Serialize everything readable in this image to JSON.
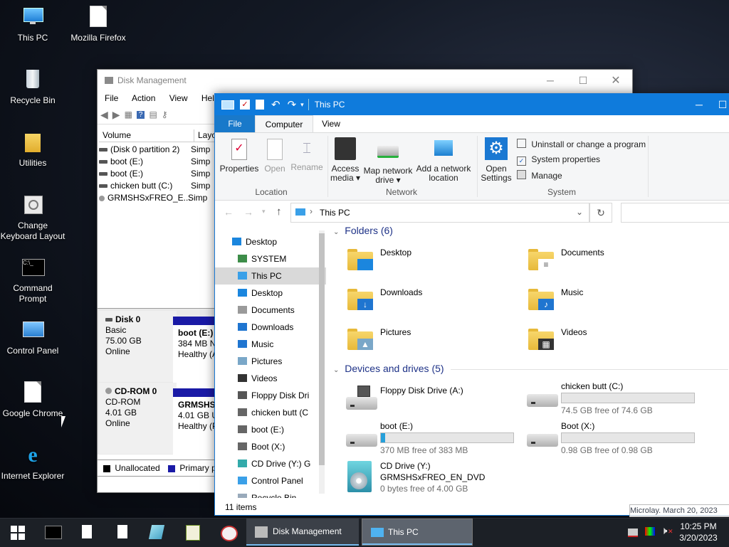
{
  "desktop": {
    "icons": [
      {
        "label": "This PC"
      },
      {
        "label": "Mozilla Firefox"
      },
      {
        "label": "Recycle Bin"
      },
      {
        "label": "Utilities"
      },
      {
        "label": "Change Keyboard Layout"
      },
      {
        "label": "Command Prompt"
      },
      {
        "label": "Control Panel"
      },
      {
        "label": "Google Chrome"
      },
      {
        "label": "Internet Explorer"
      }
    ],
    "watermark": "Microlay. March 20, 2023"
  },
  "disk_management": {
    "title": "Disk Management",
    "menu": [
      "File",
      "Action",
      "View",
      "Help"
    ],
    "columns": [
      "Volume",
      "Layout"
    ],
    "volumes": [
      {
        "name": "(Disk 0 partition 2)",
        "layout": "Simp"
      },
      {
        "name": "boot (E:)",
        "layout": "Simp"
      },
      {
        "name": "boot (E:)",
        "layout": "Simp"
      },
      {
        "name": "chicken butt (C:)",
        "layout": "Simp"
      },
      {
        "name": "GRMSHSxFREO_E...",
        "layout": "Simp"
      }
    ],
    "disks": [
      {
        "name": "Disk 0",
        "type": "Basic",
        "size": "75.00 GB",
        "status": "Online",
        "part_name": "boot  (E:)",
        "part_size": "384 MB N",
        "part_status": "Healthy (A"
      },
      {
        "name": "CD-ROM 0",
        "type": "CD-ROM",
        "size": "4.01 GB",
        "status": "Online",
        "part_name": "GRMSHS",
        "part_size": "4.01 GB U",
        "part_status": "Healthy (P"
      }
    ],
    "legend": [
      {
        "label": "Unallocated",
        "color": "#000000"
      },
      {
        "label": "Primary pa",
        "color": "#1a1aa6"
      }
    ]
  },
  "explorer": {
    "title": "This PC",
    "tabs": {
      "file": "File",
      "computer": "Computer",
      "view": "View"
    },
    "ribbon": {
      "location": {
        "label": "Location",
        "properties": "Properties",
        "open": "Open",
        "rename": "Rename"
      },
      "network": {
        "label": "Network",
        "access_media_1": "Access",
        "access_media_2": "media ▾",
        "map_drive_1": "Map network",
        "map_drive_2": "drive ▾",
        "add_location_1": "Add a network",
        "add_location_2": "location"
      },
      "system": {
        "label": "System",
        "open_settings_1": "Open",
        "open_settings_2": "Settings",
        "uninstall": "Uninstall or change a program",
        "system_properties": "System properties",
        "manage": "Manage"
      }
    },
    "address": {
      "path": "This PC"
    },
    "nav": [
      {
        "label": "Desktop",
        "indent": 0
      },
      {
        "label": "SYSTEM",
        "indent": 1
      },
      {
        "label": "This PC",
        "indent": 1
      },
      {
        "label": "Desktop",
        "indent": 2
      },
      {
        "label": "Documents",
        "indent": 2
      },
      {
        "label": "Downloads",
        "indent": 2
      },
      {
        "label": "Music",
        "indent": 2
      },
      {
        "label": "Pictures",
        "indent": 2
      },
      {
        "label": "Videos",
        "indent": 2
      },
      {
        "label": "Floppy Disk Dri",
        "indent": 2
      },
      {
        "label": "chicken butt (C",
        "indent": 2
      },
      {
        "label": "boot (E:)",
        "indent": 2
      },
      {
        "label": "Boot (X:)",
        "indent": 2
      },
      {
        "label": "CD Drive (Y:) G",
        "indent": 2
      },
      {
        "label": "Control Panel",
        "indent": 1
      },
      {
        "label": "Recycle Bin",
        "indent": 1
      }
    ],
    "folders_header": "Folders (6)",
    "folders": [
      "Desktop",
      "Documents",
      "Downloads",
      "Music",
      "Pictures",
      "Videos"
    ],
    "drives_header": "Devices and drives (5)",
    "drives": {
      "floppy": {
        "name": "Floppy Disk Drive (A:)"
      },
      "c": {
        "name": "chicken butt (C:)",
        "free": "74.5 GB free of 74.6 GB",
        "used_fraction": 0.0
      },
      "e": {
        "name": "boot (E:)",
        "free": "370 MB free of 383 MB",
        "used_fraction": 0.034
      },
      "x": {
        "name": "Boot (X:)",
        "free": "0.98 GB free of 0.98 GB",
        "used_fraction": 0.0
      },
      "y": {
        "name": "CD Drive (Y:)",
        "label": "GRMSHSxFREO_EN_DVD",
        "free": "0 bytes free of 4.00 GB"
      }
    },
    "status": "11 items"
  },
  "taskbar": {
    "disk_mgmt": "Disk Management",
    "this_pc": "This PC",
    "time": "10:25 PM",
    "date": "3/20/2023"
  }
}
